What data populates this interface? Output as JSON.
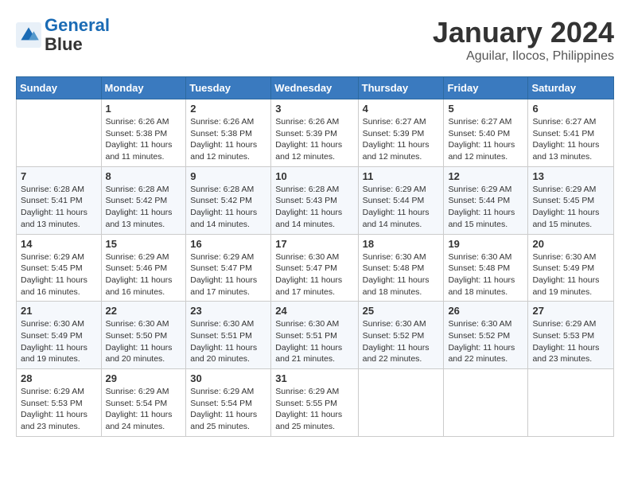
{
  "logo": {
    "line1": "General",
    "line2": "Blue"
  },
  "title": "January 2024",
  "subtitle": "Aguilar, Ilocos, Philippines",
  "weekdays": [
    "Sunday",
    "Monday",
    "Tuesday",
    "Wednesday",
    "Thursday",
    "Friday",
    "Saturday"
  ],
  "weeks": [
    [
      {
        "day": "",
        "info": ""
      },
      {
        "day": "1",
        "info": "Sunrise: 6:26 AM\nSunset: 5:38 PM\nDaylight: 11 hours and 11 minutes."
      },
      {
        "day": "2",
        "info": "Sunrise: 6:26 AM\nSunset: 5:38 PM\nDaylight: 11 hours and 12 minutes."
      },
      {
        "day": "3",
        "info": "Sunrise: 6:26 AM\nSunset: 5:39 PM\nDaylight: 11 hours and 12 minutes."
      },
      {
        "day": "4",
        "info": "Sunrise: 6:27 AM\nSunset: 5:39 PM\nDaylight: 11 hours and 12 minutes."
      },
      {
        "day": "5",
        "info": "Sunrise: 6:27 AM\nSunset: 5:40 PM\nDaylight: 11 hours and 12 minutes."
      },
      {
        "day": "6",
        "info": "Sunrise: 6:27 AM\nSunset: 5:41 PM\nDaylight: 11 hours and 13 minutes."
      }
    ],
    [
      {
        "day": "7",
        "info": "Sunrise: 6:28 AM\nSunset: 5:41 PM\nDaylight: 11 hours and 13 minutes."
      },
      {
        "day": "8",
        "info": "Sunrise: 6:28 AM\nSunset: 5:42 PM\nDaylight: 11 hours and 13 minutes."
      },
      {
        "day": "9",
        "info": "Sunrise: 6:28 AM\nSunset: 5:42 PM\nDaylight: 11 hours and 14 minutes."
      },
      {
        "day": "10",
        "info": "Sunrise: 6:28 AM\nSunset: 5:43 PM\nDaylight: 11 hours and 14 minutes."
      },
      {
        "day": "11",
        "info": "Sunrise: 6:29 AM\nSunset: 5:44 PM\nDaylight: 11 hours and 14 minutes."
      },
      {
        "day": "12",
        "info": "Sunrise: 6:29 AM\nSunset: 5:44 PM\nDaylight: 11 hours and 15 minutes."
      },
      {
        "day": "13",
        "info": "Sunrise: 6:29 AM\nSunset: 5:45 PM\nDaylight: 11 hours and 15 minutes."
      }
    ],
    [
      {
        "day": "14",
        "info": "Sunrise: 6:29 AM\nSunset: 5:45 PM\nDaylight: 11 hours and 16 minutes."
      },
      {
        "day": "15",
        "info": "Sunrise: 6:29 AM\nSunset: 5:46 PM\nDaylight: 11 hours and 16 minutes."
      },
      {
        "day": "16",
        "info": "Sunrise: 6:29 AM\nSunset: 5:47 PM\nDaylight: 11 hours and 17 minutes."
      },
      {
        "day": "17",
        "info": "Sunrise: 6:30 AM\nSunset: 5:47 PM\nDaylight: 11 hours and 17 minutes."
      },
      {
        "day": "18",
        "info": "Sunrise: 6:30 AM\nSunset: 5:48 PM\nDaylight: 11 hours and 18 minutes."
      },
      {
        "day": "19",
        "info": "Sunrise: 6:30 AM\nSunset: 5:48 PM\nDaylight: 11 hours and 18 minutes."
      },
      {
        "day": "20",
        "info": "Sunrise: 6:30 AM\nSunset: 5:49 PM\nDaylight: 11 hours and 19 minutes."
      }
    ],
    [
      {
        "day": "21",
        "info": "Sunrise: 6:30 AM\nSunset: 5:49 PM\nDaylight: 11 hours and 19 minutes."
      },
      {
        "day": "22",
        "info": "Sunrise: 6:30 AM\nSunset: 5:50 PM\nDaylight: 11 hours and 20 minutes."
      },
      {
        "day": "23",
        "info": "Sunrise: 6:30 AM\nSunset: 5:51 PM\nDaylight: 11 hours and 20 minutes."
      },
      {
        "day": "24",
        "info": "Sunrise: 6:30 AM\nSunset: 5:51 PM\nDaylight: 11 hours and 21 minutes."
      },
      {
        "day": "25",
        "info": "Sunrise: 6:30 AM\nSunset: 5:52 PM\nDaylight: 11 hours and 22 minutes."
      },
      {
        "day": "26",
        "info": "Sunrise: 6:30 AM\nSunset: 5:52 PM\nDaylight: 11 hours and 22 minutes."
      },
      {
        "day": "27",
        "info": "Sunrise: 6:29 AM\nSunset: 5:53 PM\nDaylight: 11 hours and 23 minutes."
      }
    ],
    [
      {
        "day": "28",
        "info": "Sunrise: 6:29 AM\nSunset: 5:53 PM\nDaylight: 11 hours and 23 minutes."
      },
      {
        "day": "29",
        "info": "Sunrise: 6:29 AM\nSunset: 5:54 PM\nDaylight: 11 hours and 24 minutes."
      },
      {
        "day": "30",
        "info": "Sunrise: 6:29 AM\nSunset: 5:54 PM\nDaylight: 11 hours and 25 minutes."
      },
      {
        "day": "31",
        "info": "Sunrise: 6:29 AM\nSunset: 5:55 PM\nDaylight: 11 hours and 25 minutes."
      },
      {
        "day": "",
        "info": ""
      },
      {
        "day": "",
        "info": ""
      },
      {
        "day": "",
        "info": ""
      }
    ]
  ]
}
